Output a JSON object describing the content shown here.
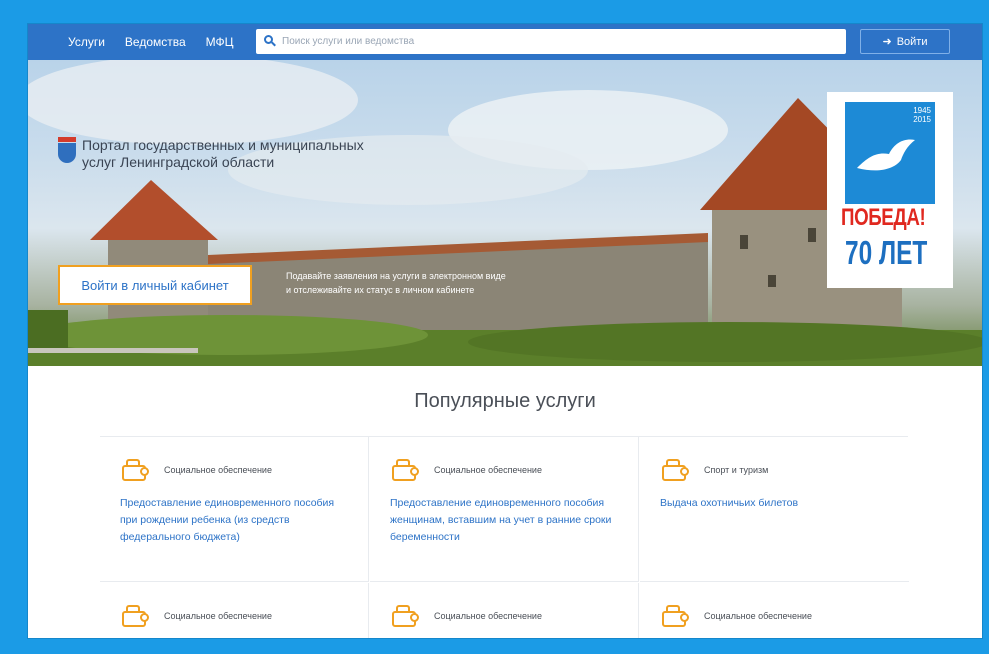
{
  "nav": {
    "items": [
      "Услуги",
      "Ведомства",
      "МФЦ"
    ],
    "search_placeholder": "Поиск услуги или ведомства",
    "login_label": "Войти"
  },
  "hero": {
    "brand_line1": "Портал государственных и муниципальных",
    "brand_line2": "услуг Ленинградской области",
    "cabinet_button": "Войти в личный кабинет",
    "note_line1": "Подавайте заявления на услуги в электронном виде",
    "note_line2": "и отслеживайте их статус в личном кабинете",
    "victory": {
      "years_from": "1945",
      "years_to": "2015",
      "word": "ПОБЕДА!",
      "years": "70 ЛЕТ"
    }
  },
  "popular": {
    "title": "Популярные услуги",
    "services": [
      {
        "category": "Социальное обеспечение",
        "icon": "wallet-icon",
        "title": "Предоставление единовременного пособия при рождении ребенка (из средств федерального бюджета)"
      },
      {
        "category": "Социальное обеспечение",
        "icon": "wallet-icon",
        "title": "Предоставление единовременного пособия женщинам, вставшим на учет в ранние сроки беременности"
      },
      {
        "category": "Спорт и туризм",
        "icon": "luggage-icon",
        "title": "Выдача охотничьих билетов"
      },
      {
        "category": "Социальное обеспечение",
        "icon": "wallet-icon",
        "title": ""
      },
      {
        "category": "Социальное обеспечение",
        "icon": "wallet-icon",
        "title": ""
      },
      {
        "category": "Социальное обеспечение",
        "icon": "wallet-icon",
        "title": ""
      }
    ]
  },
  "colors": {
    "nav_bg": "#2d73c7",
    "accent": "#f0a020",
    "link": "#2d73c7",
    "page_bg": "#1b9be6",
    "victory_red": "#e0281f"
  }
}
